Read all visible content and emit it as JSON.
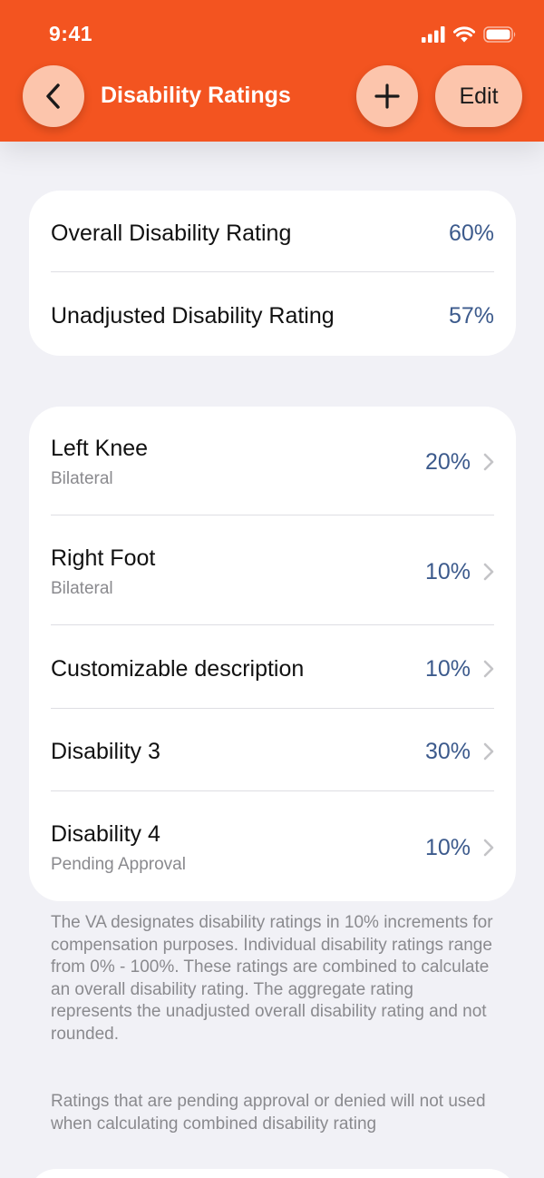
{
  "status_bar": {
    "time": "9:41",
    "icons": [
      "cellular-signal-icon",
      "wifi-icon",
      "battery-icon"
    ]
  },
  "nav": {
    "title": "Disability Ratings",
    "back_icon": "chevron-left-icon",
    "add_icon": "plus-icon",
    "edit_label": "Edit"
  },
  "summary": {
    "overall_label": "Overall Disability Rating",
    "overall_value": "60%",
    "unadjusted_label": "Unadjusted Disability Rating",
    "unadjusted_value": "57%"
  },
  "ratings": [
    {
      "title": "Left Knee",
      "subtitle": "Bilateral",
      "value": "20%"
    },
    {
      "title": "Right Foot",
      "subtitle": "Bilateral",
      "value": "10%"
    },
    {
      "title": "Customizable description",
      "subtitle": "",
      "value": "10%"
    },
    {
      "title": "Disability 3",
      "subtitle": "",
      "value": "30%"
    },
    {
      "title": "Disability 4",
      "subtitle": "Pending Approval",
      "value": "10%"
    }
  ],
  "footer": {
    "note_1": "The VA designates disability ratings in 10% increments for compensation purposes. Individual disability ratings range from 0% - 100%. These ratings are combined to calculate an overall disability rating. The aggregate rating represents the unadjusted overall disability rating and not rounded.",
    "note_2": "Ratings that are pending approval or denied will not used when calculating combined disability rating"
  },
  "colors": {
    "header": "#F35420",
    "button_fill": "#FCC5AC",
    "value_text": "#3C5A8C",
    "background": "#F1F1F6"
  }
}
